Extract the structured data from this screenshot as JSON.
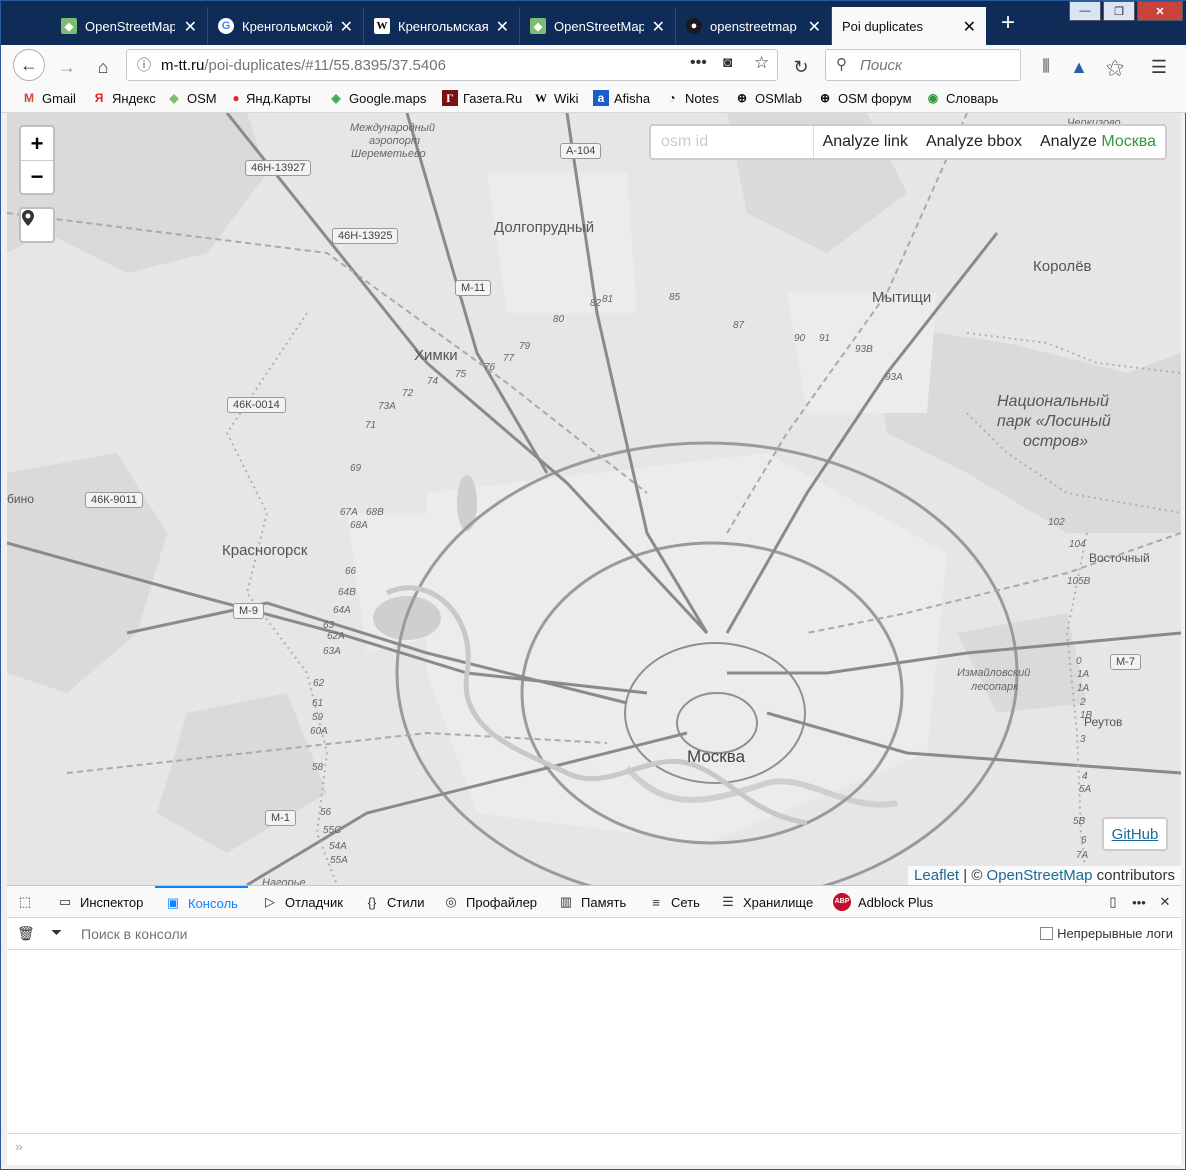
{
  "tabs": [
    {
      "title": "OpenStreetMap",
      "icon": "osm-icon",
      "active": false
    },
    {
      "title": "Кренгольмской",
      "icon": "google-icon",
      "active": false
    },
    {
      "title": "Кренгольмская",
      "icon": "wikipedia-icon",
      "active": false
    },
    {
      "title": "OpenStreetMap",
      "icon": "osm-icon",
      "active": false
    },
    {
      "title": "openstreetmap",
      "icon": "github-icon",
      "active": false
    },
    {
      "title": "Poi duplicates",
      "icon": "",
      "active": true
    }
  ],
  "nav": {
    "url_domain": "m-tt.ru",
    "url_path": "/poi-duplicates/#11/55.8395/37.5406",
    "search_placeholder": "Поиск"
  },
  "bookmarks": [
    {
      "label": "Gmail",
      "icon": "gmail-icon"
    },
    {
      "label": "Яндекс",
      "icon": "yandex-icon"
    },
    {
      "label": "OSM",
      "icon": "osm-icon"
    },
    {
      "label": "Янд.Карты",
      "icon": "map-pin-icon"
    },
    {
      "label": "Google.maps",
      "icon": "google-maps-icon"
    },
    {
      "label": "Газета.Ru",
      "icon": "gazeta-icon"
    },
    {
      "label": "Wiki",
      "icon": "wikipedia-icon"
    },
    {
      "label": "Afisha",
      "icon": "afisha-icon"
    },
    {
      "label": "Notes",
      "icon": "rss-icon"
    },
    {
      "label": "OSMlab",
      "icon": "globe-icon"
    },
    {
      "label": "OSM форум",
      "icon": "globe-icon"
    },
    {
      "label": "Словарь",
      "icon": "dictionary-icon"
    }
  ],
  "map": {
    "osm_id_placeholder": "osm id",
    "analyze_link": "Analyze link",
    "analyze_bbox": "Analyze bbox",
    "analyze_prefix": "Analyze",
    "analyze_city": "Москва",
    "github": "GitHub",
    "attribution_leaflet": "Leaflet",
    "attribution_sep": " | © ",
    "attribution_osm": "OpenStreetMap",
    "attribution_tail": " contributors",
    "zoom_in": "+",
    "zoom_out": "−",
    "places": {
      "moscow": "Москва",
      "dolgoprudny": "Долгопрудный",
      "khimki": "Химки",
      "mytishchi": "Мытищи",
      "korolev": "Королёв",
      "krasnogorsk": "Красногорск",
      "vostochny": "Восточный",
      "reutov": "Реутов",
      "park_line1": "Национальный",
      "park_line2": "парк «Лосиный",
      "park_line3": "остров»",
      "izm_line1": "Измайловский",
      "izm_line2": "лесопарк",
      "airport_line1": "Международный",
      "airport_line2": "аэропорт",
      "airport_line3": "Шереметьево",
      "left_cut": "бино",
      "top_right_cut": "Черкизово",
      "bottom_cut": "Нагорье"
    },
    "shields": {
      "s1": "46Н-13927",
      "s2": "А-104",
      "s3": "46Н-13925",
      "s4": "М-11",
      "s5": "46К-0014",
      "s6": "46К-9011",
      "s7": "М-9",
      "s8": "М-1",
      "s9": "М-7"
    },
    "km": [
      "82",
      "81",
      "85",
      "87",
      "90",
      "91",
      "93В",
      "93А",
      "80",
      "79",
      "77",
      "76",
      "75",
      "74",
      "72",
      "73А",
      "71",
      "69",
      "67А",
      "68В",
      "68А",
      "66",
      "64В",
      "64А",
      "63",
      "62А",
      "63А",
      "62",
      "61",
      "59",
      "60А",
      "58",
      "56",
      "55С",
      "54А",
      "55А",
      "102",
      "104",
      "105В",
      "0",
      "1А",
      "1А",
      "2",
      "1В",
      "3",
      "4",
      "5А",
      "5В",
      "6",
      "7А"
    ]
  },
  "devtools": {
    "tabs": [
      {
        "label": "Инспектор",
        "icon": "inspector-icon"
      },
      {
        "label": "Консоль",
        "icon": "console-icon"
      },
      {
        "label": "Отладчик",
        "icon": "debugger-icon"
      },
      {
        "label": "Стили",
        "icon": "braces-icon"
      },
      {
        "label": "Профайлер",
        "icon": "profiler-icon"
      },
      {
        "label": "Память",
        "icon": "memory-icon"
      },
      {
        "label": "Сеть",
        "icon": "network-icon"
      },
      {
        "label": "Хранилище",
        "icon": "storage-icon"
      },
      {
        "label": "Adblock Plus",
        "icon": "abp-icon"
      }
    ],
    "filter_placeholder": "Поиск в консоли",
    "persist_logs": "Непрерывные логи"
  }
}
